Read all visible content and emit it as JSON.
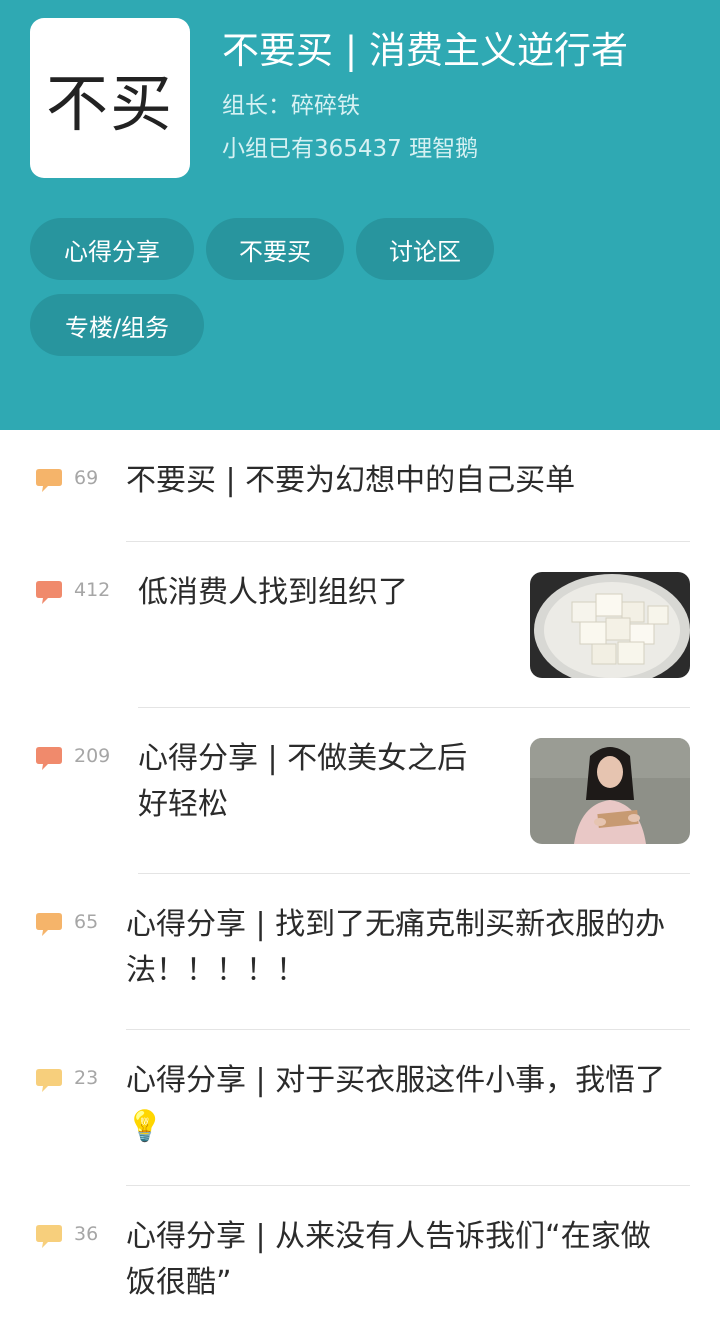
{
  "group": {
    "logo_text": "不买",
    "title": "不要买 | 消费主义逆行者",
    "leader": "组长：碎碎铁",
    "members": "小组已有365437 理智鹅"
  },
  "tags": [
    "心得分享",
    "不要买",
    "讨论区",
    "专楼/组务"
  ],
  "colors": {
    "header_bg": "#2fa9b3",
    "chip_bg": "#28959e",
    "bubble_hot": "#f08a6c",
    "bubble_warm": "#f5b46a",
    "bubble_mild": "#f7cf7c"
  },
  "posts": [
    {
      "count": "69",
      "title": "不要买 | 不要为幻想中的自己买单",
      "icon": "comment-icon"
    },
    {
      "count": "412",
      "title": "低消费人找到组织了",
      "icon": "comment-icon",
      "thumbnail": "tofu-photo"
    },
    {
      "count": "209",
      "title": "心得分享 | 不做美女之后好轻松",
      "icon": "comment-icon",
      "thumbnail": "woman-reading-photo"
    },
    {
      "count": "65",
      "title": "心得分享 | 找到了无痛克制买新衣服的办法！！！！！",
      "icon": "comment-icon"
    },
    {
      "count": "23",
      "title": "心得分享 | 对于买衣服这件小事，我悟了",
      "icon": "comment-icon",
      "emoji": "💡"
    },
    {
      "count": "36",
      "title": "心得分享 | 从来没有人告诉我们“在家做饭很酷”",
      "icon": "comment-icon"
    }
  ]
}
